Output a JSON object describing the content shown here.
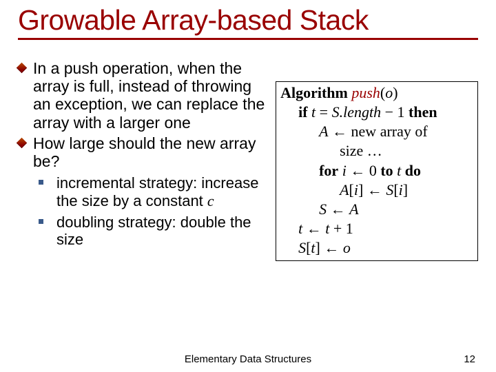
{
  "title": "Growable Array-based Stack",
  "bullets": {
    "b1": "In a push operation, when the array is full, instead of throwing an exception, we can replace the array with a larger one",
    "b2": "How large should the new array be?"
  },
  "sub": {
    "s1_pre": "incremental strategy: increase the size by a constant ",
    "s1_var": "c",
    "s2": "doubling strategy: double the size"
  },
  "algo": {
    "kw_algorithm": "Algorithm",
    "fn_name": "push",
    "lp": "(",
    "param": "o",
    "rp": ")",
    "kw_if": "if",
    "kw_then": "then",
    "kw_for": "for",
    "kw_to": "to",
    "kw_do": "do",
    "var_t": "t",
    "var_S": "S",
    "var_A": "A",
    "var_i": "i",
    "var_o": "o",
    "eq": " = ",
    "length": ".length",
    "minus": " − ",
    "one": "1",
    "zero": "0",
    "plus": " + ",
    "arrow": " ← ",
    "newarr1": " new array of",
    "newarr2": "size …",
    "lbr": "[",
    "rbr": "]"
  },
  "footer": {
    "label": "Elementary Data Structures",
    "num": "12"
  }
}
